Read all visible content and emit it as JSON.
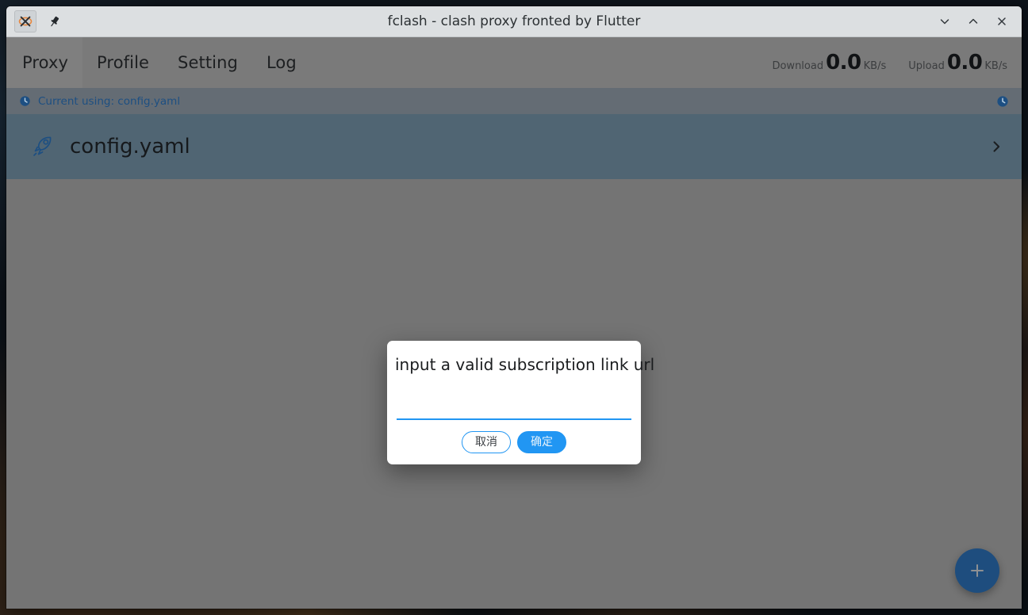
{
  "window": {
    "title": "fclash - clash proxy fronted by Flutter",
    "app_icon": "fclash-app-icon",
    "pin_icon": "pin-icon",
    "controls": [
      {
        "name": "minimize",
        "icon": "chevron-down-icon"
      },
      {
        "name": "maximize",
        "icon": "chevron-up-icon"
      },
      {
        "name": "close",
        "icon": "close-icon"
      }
    ]
  },
  "nav": {
    "tabs": [
      {
        "label": "Proxy",
        "active": true
      },
      {
        "label": "Profile",
        "active": false
      },
      {
        "label": "Setting",
        "active": false
      },
      {
        "label": "Log",
        "active": false
      }
    ]
  },
  "speeds": {
    "download": {
      "label": "Download",
      "value": "0.0",
      "unit": "KB/s"
    },
    "upload": {
      "label": "Upload",
      "value": "0.0",
      "unit": "KB/s"
    }
  },
  "status": {
    "icon": "clock-icon",
    "text": "Current using: config.yaml",
    "right_icon": "clock-icon"
  },
  "profile_card": {
    "icon": "rocket-icon",
    "name": "config.yaml",
    "chevron": "chevron-right-icon"
  },
  "fab": {
    "icon": "plus-icon",
    "label": "+"
  },
  "dialog": {
    "title": "input a valid subscription link url",
    "input": {
      "value": "",
      "placeholder": ""
    },
    "buttons": {
      "cancel": "取消",
      "confirm": "确定"
    }
  },
  "colors": {
    "titlebar": "#dcdfe1",
    "navbar": "#7a7a7a",
    "statusbar": "#646c74",
    "profile_card": "#506573",
    "content_scrim": "#747474",
    "accent_blue": "#2196f3",
    "status_text": "#1d4f82",
    "fab": "#1e4d7e"
  }
}
